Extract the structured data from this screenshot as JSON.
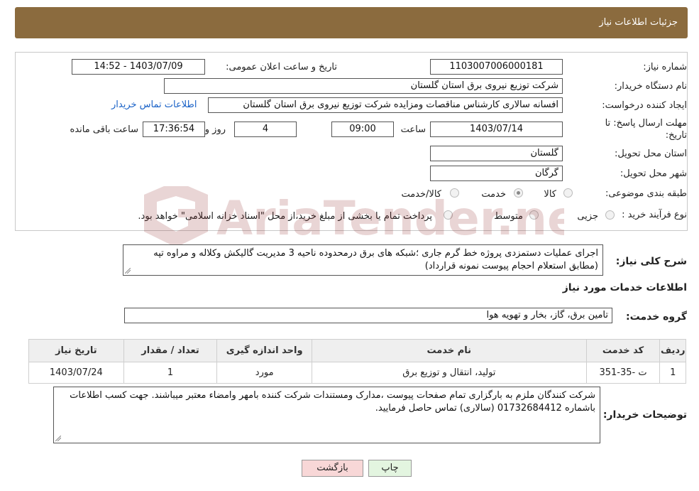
{
  "header": {
    "title": "جزئیات اطلاعات نیاز"
  },
  "form": {
    "need_number_label": "شماره نیاز:",
    "need_number": "1103007006000181",
    "announce_label": "تاریخ و ساعت اعلان عمومی:",
    "announce_value": "1403/07/09 - 14:52",
    "buyer_label": "نام دستگاه خریدار:",
    "buyer_value": "شرکت توزیع نیروی برق استان گلستان",
    "creator_label": "ایجاد کننده درخواست:",
    "creator_value": "افسانه سالاری کارشناس مناقصات ومزایده شرکت توزیع نیروی برق استان گلستان",
    "contact_link": "اطلاعات تماس خریدار",
    "deadline_label_1": "مهلت ارسال پاسخ: تا",
    "deadline_label_2": "تاریخ:",
    "deadline_date": "1403/07/14",
    "time_label": "ساعت",
    "deadline_time": "09:00",
    "days_value": "4",
    "days_label": "روز و",
    "remaining_time": "17:36:54",
    "remaining_label": "ساعت باقی مانده",
    "province_label": "استان محل تحویل:",
    "province_value": "گلستان",
    "city_label": "شهر محل تحویل:",
    "city_value": "گرگان",
    "category_label": "طبقه بندی موضوعی:",
    "category_options": [
      "کالا",
      "خدمت",
      "کالا/خدمت"
    ],
    "category_selected": "خدمت",
    "process_label": "نوع فرآیند خرید :",
    "process_options": [
      "جزیی",
      "متوسط"
    ],
    "process_note": "پرداخت تمام یا بخشی از مبلغ خرید،از محل \"اسناد خزانه اسلامی\" خواهد بود."
  },
  "watermark": {
    "text": "AriaTender.neT"
  },
  "description": {
    "label": "شرح کلی نیاز:",
    "text": "اجرای عملیات دستمزدی پروژه خط گرم جاری  ؛شبکه های برق درمحدوده ناحیه 3 مدیریت  گالیکش وکلاله و مراوه تپه  (مطابق استعلام احجام پیوست نمونه قرارداد)"
  },
  "services": {
    "section_title": "اطلاعات خدمات مورد نیاز",
    "group_label": "گروه خدمت:",
    "group_value": "تامین برق، گاز، بخار و تهویه هوا",
    "columns": [
      "ردیف",
      "کد خدمت",
      "نام خدمت",
      "واحد اندازه گیری",
      "تعداد / مقدار",
      "تاریخ نیاز"
    ],
    "rows": [
      [
        "1",
        "ت -35-351",
        "تولید، انتقال و توزیع برق",
        "مورد",
        "1",
        "1403/07/24"
      ]
    ]
  },
  "buyer_notes": {
    "label": "توضیحات خریدار:",
    "text": "شرکت کنندگان ملزم به بارگزاری تمام صفحات پیوست ،مدارک ومستندات شرکت کننده بامهر وامضاء معتبر میباشند. جهت کسب اطلاعات باشماره 01732684412 (سالاری) تماس حاصل فرمایید."
  },
  "buttons": {
    "print": "چاپ",
    "back": "بازگشت"
  },
  "colors": {
    "header_bg": "#8b6b3e",
    "link": "#1a62c7",
    "back_btn": "#f8d7d7",
    "print_btn": "#e3f5e0"
  }
}
